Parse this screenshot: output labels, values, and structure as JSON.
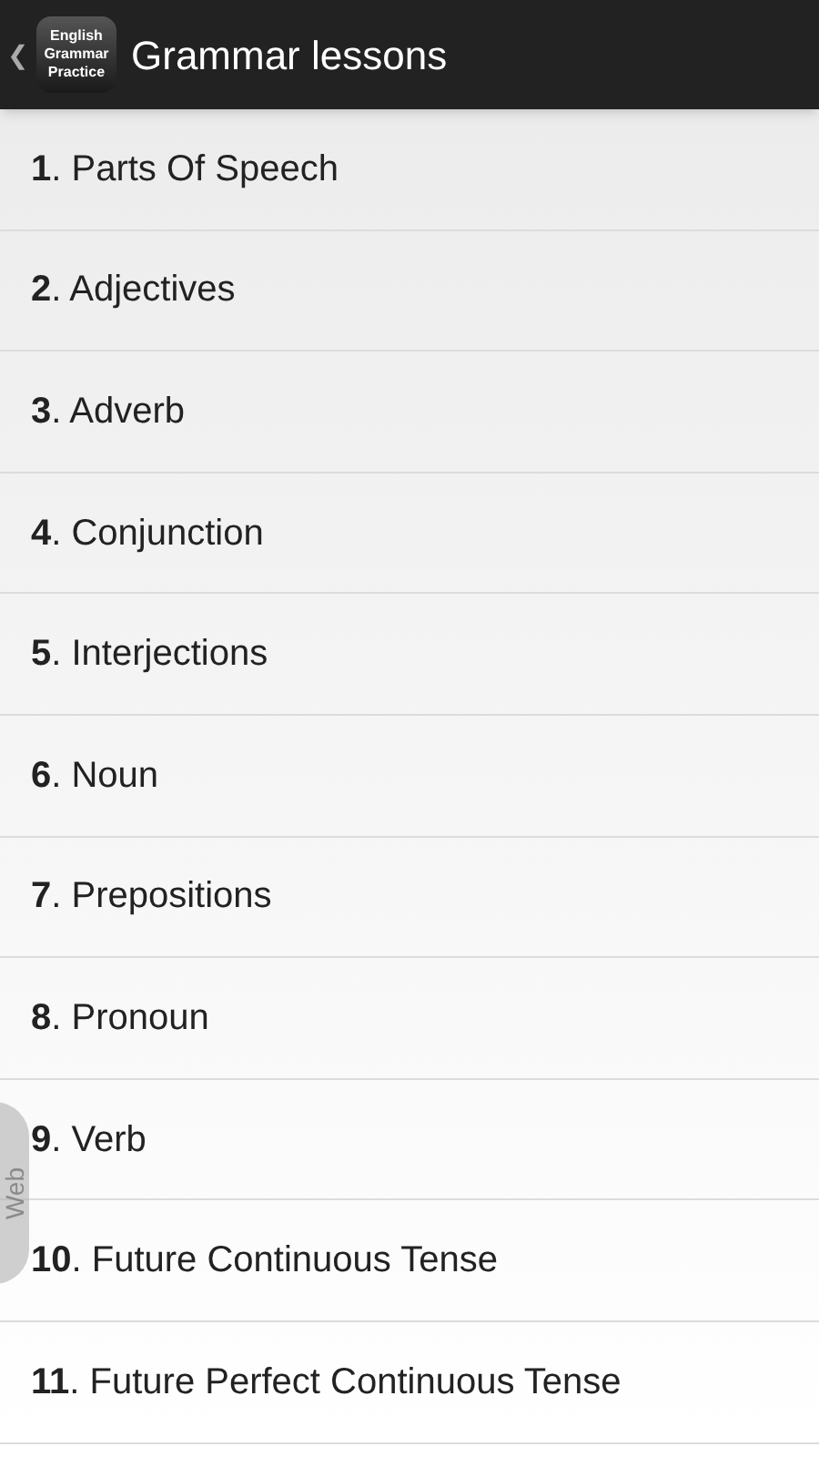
{
  "header": {
    "back_icon": "❮",
    "app_badge": "English Grammar Practice",
    "title": "Grammar lessons"
  },
  "lessons": [
    {
      "text": "**1**. Parts Of Speech"
    },
    {
      "text": "**2**. Adjectives"
    },
    {
      "text": "**3**. Adverb"
    },
    {
      "text": "**4**. Conjunction"
    },
    {
      "text": "**5**. Interjections"
    },
    {
      "text": "**6**. Noun"
    },
    {
      "text": "**7**. Prepositions"
    },
    {
      "text": "**8**. Pronoun"
    },
    {
      "text": "**9**. Verb"
    },
    {
      "text": "**10**. Future Continuous Tense"
    },
    {
      "text": "**11**. Future Perfect Continuous Tense"
    }
  ],
  "floating_tab": {
    "label": "Web"
  }
}
